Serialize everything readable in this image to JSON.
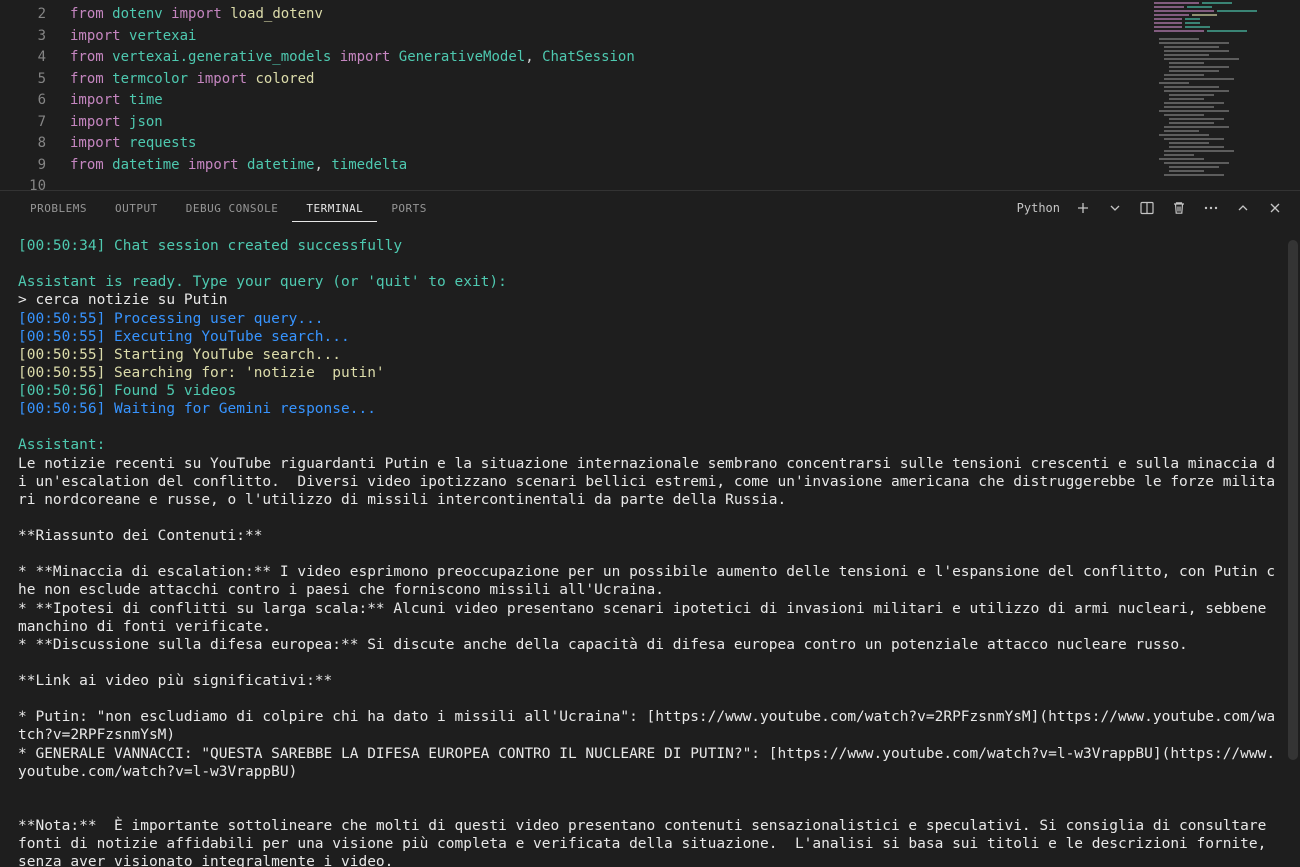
{
  "editor": {
    "lines": [
      {
        "num": "2",
        "tokens": [
          [
            "kw",
            "from"
          ],
          [
            "",
            ""
          ],
          [
            "mod",
            "dotenv"
          ],
          [
            "",
            ""
          ],
          [
            "kw",
            "import"
          ],
          [
            "",
            ""
          ],
          [
            "fn",
            "load_dotenv"
          ]
        ]
      },
      {
        "num": "3",
        "tokens": [
          [
            "kw",
            "import"
          ],
          [
            "",
            ""
          ],
          [
            "mod",
            "vertexai"
          ]
        ]
      },
      {
        "num": "4",
        "tokens": [
          [
            "kw",
            "from"
          ],
          [
            "",
            ""
          ],
          [
            "mod",
            "vertexai.generative_models"
          ],
          [
            "",
            ""
          ],
          [
            "kw",
            "import"
          ],
          [
            "",
            ""
          ],
          [
            "cls",
            "GenerativeModel"
          ],
          [
            "punct",
            ","
          ],
          [
            "",
            ""
          ],
          [
            "cls",
            "ChatSession"
          ]
        ]
      },
      {
        "num": "5",
        "tokens": [
          [
            "kw",
            "from"
          ],
          [
            "",
            ""
          ],
          [
            "mod",
            "termcolor"
          ],
          [
            "",
            ""
          ],
          [
            "kw",
            "import"
          ],
          [
            "",
            ""
          ],
          [
            "fn",
            "colored"
          ]
        ]
      },
      {
        "num": "6",
        "tokens": [
          [
            "kw",
            "import"
          ],
          [
            "",
            ""
          ],
          [
            "mod",
            "time"
          ]
        ]
      },
      {
        "num": "7",
        "tokens": [
          [
            "kw",
            "import"
          ],
          [
            "",
            ""
          ],
          [
            "mod",
            "json"
          ]
        ]
      },
      {
        "num": "8",
        "tokens": [
          [
            "kw",
            "import"
          ],
          [
            "",
            ""
          ],
          [
            "mod",
            "requests"
          ]
        ]
      },
      {
        "num": "9",
        "tokens": [
          [
            "kw",
            "from"
          ],
          [
            "",
            ""
          ],
          [
            "mod",
            "datetime"
          ],
          [
            "",
            ""
          ],
          [
            "kw",
            "import"
          ],
          [
            "",
            ""
          ],
          [
            "mod",
            "datetime"
          ],
          [
            "punct",
            ","
          ],
          [
            "",
            ""
          ],
          [
            "mod",
            "timedelta"
          ]
        ]
      },
      {
        "num": "10",
        "tokens": []
      }
    ]
  },
  "panel": {
    "tabs": {
      "problems": "PROBLEMS",
      "output": "OUTPUT",
      "debug": "DEBUG CONSOLE",
      "terminal": "TERMINAL",
      "ports": "PORTS"
    },
    "language": "Python"
  },
  "terminal": {
    "lines": [
      {
        "cls": "t-green",
        "text": "[00:50:34] Chat session created successfully"
      },
      {
        "cls": "",
        "text": " "
      },
      {
        "cls": "t-green",
        "text": "Assistant is ready. Type your query (or 'quit' to exit):"
      },
      {
        "cls": "t-white",
        "text": "> cerca notizie su Putin"
      },
      {
        "cls": "t-cyan",
        "text": "[00:50:55] Processing user query..."
      },
      {
        "cls": "t-cyan",
        "text": "[00:50:55] Executing YouTube search..."
      },
      {
        "cls": "t-yellow",
        "text": "[00:50:55] Starting YouTube search..."
      },
      {
        "cls": "t-yellow",
        "text": "[00:50:55] Searching for: 'notizie  putin'"
      },
      {
        "cls": "t-green",
        "text": "[00:50:56] Found 5 videos"
      },
      {
        "cls": "t-cyan",
        "text": "[00:50:56] Waiting for Gemini response..."
      },
      {
        "cls": "",
        "text": " "
      },
      {
        "cls": "t-green",
        "text": "Assistant:"
      },
      {
        "cls": "t-white",
        "text": "Le notizie recenti su YouTube riguardanti Putin e la situazione internazionale sembrano concentrarsi sulle tensioni crescenti e sulla minaccia di un'escalation del conflitto.  Diversi video ipotizzano scenari bellici estremi, come un'invasione americana che distruggerebbe le forze militari nordcoreane e russe, o l'utilizzo di missili intercontinentali da parte della Russia."
      },
      {
        "cls": "",
        "text": " "
      },
      {
        "cls": "t-white",
        "text": "**Riassunto dei Contenuti:**"
      },
      {
        "cls": "",
        "text": " "
      },
      {
        "cls": "t-white",
        "text": "* **Minaccia di escalation:** I video esprimono preoccupazione per un possibile aumento delle tensioni e l'espansione del conflitto, con Putin che non esclude attacchi contro i paesi che forniscono missili all'Ucraina."
      },
      {
        "cls": "t-white",
        "text": "* **Ipotesi di conflitti su larga scala:** Alcuni video presentano scenari ipotetici di invasioni militari e utilizzo di armi nucleari, sebbene manchino di fonti verificate."
      },
      {
        "cls": "t-white",
        "text": "* **Discussione sulla difesa europea:** Si discute anche della capacità di difesa europea contro un potenziale attacco nucleare russo."
      },
      {
        "cls": "",
        "text": " "
      },
      {
        "cls": "t-white",
        "text": "**Link ai video più significativi:**"
      },
      {
        "cls": "",
        "text": " "
      },
      {
        "cls": "t-white",
        "text": "* Putin: \"non escludiamo di colpire chi ha dato i missili all'Ucraina\": [https://www.youtube.com/watch?v=2RPFzsnmYsM](https://www.youtube.com/watch?v=2RPFzsnmYsM)"
      },
      {
        "cls": "t-white",
        "text": "* GENERALE VANNACCI: \"QUESTA SAREBBE LA DIFESA EUROPEA CONTRO IL NUCLEARE DI PUTIN?\": [https://www.youtube.com/watch?v=l-w3VrappBU](https://www.youtube.com/watch?v=l-w3VrappBU)"
      },
      {
        "cls": "",
        "text": " "
      },
      {
        "cls": "",
        "text": " "
      },
      {
        "cls": "t-white",
        "text": "**Nota:**  È importante sottolineare che molti di questi video presentano contenuti sensazionalistici e speculativi. Si consiglia di consultare fonti di notizie affidabili per una visione più completa e verificata della situazione.  L'analisi si basa sui titoli e le descrizioni fornite, senza aver visionato integralmente i video."
      }
    ]
  }
}
